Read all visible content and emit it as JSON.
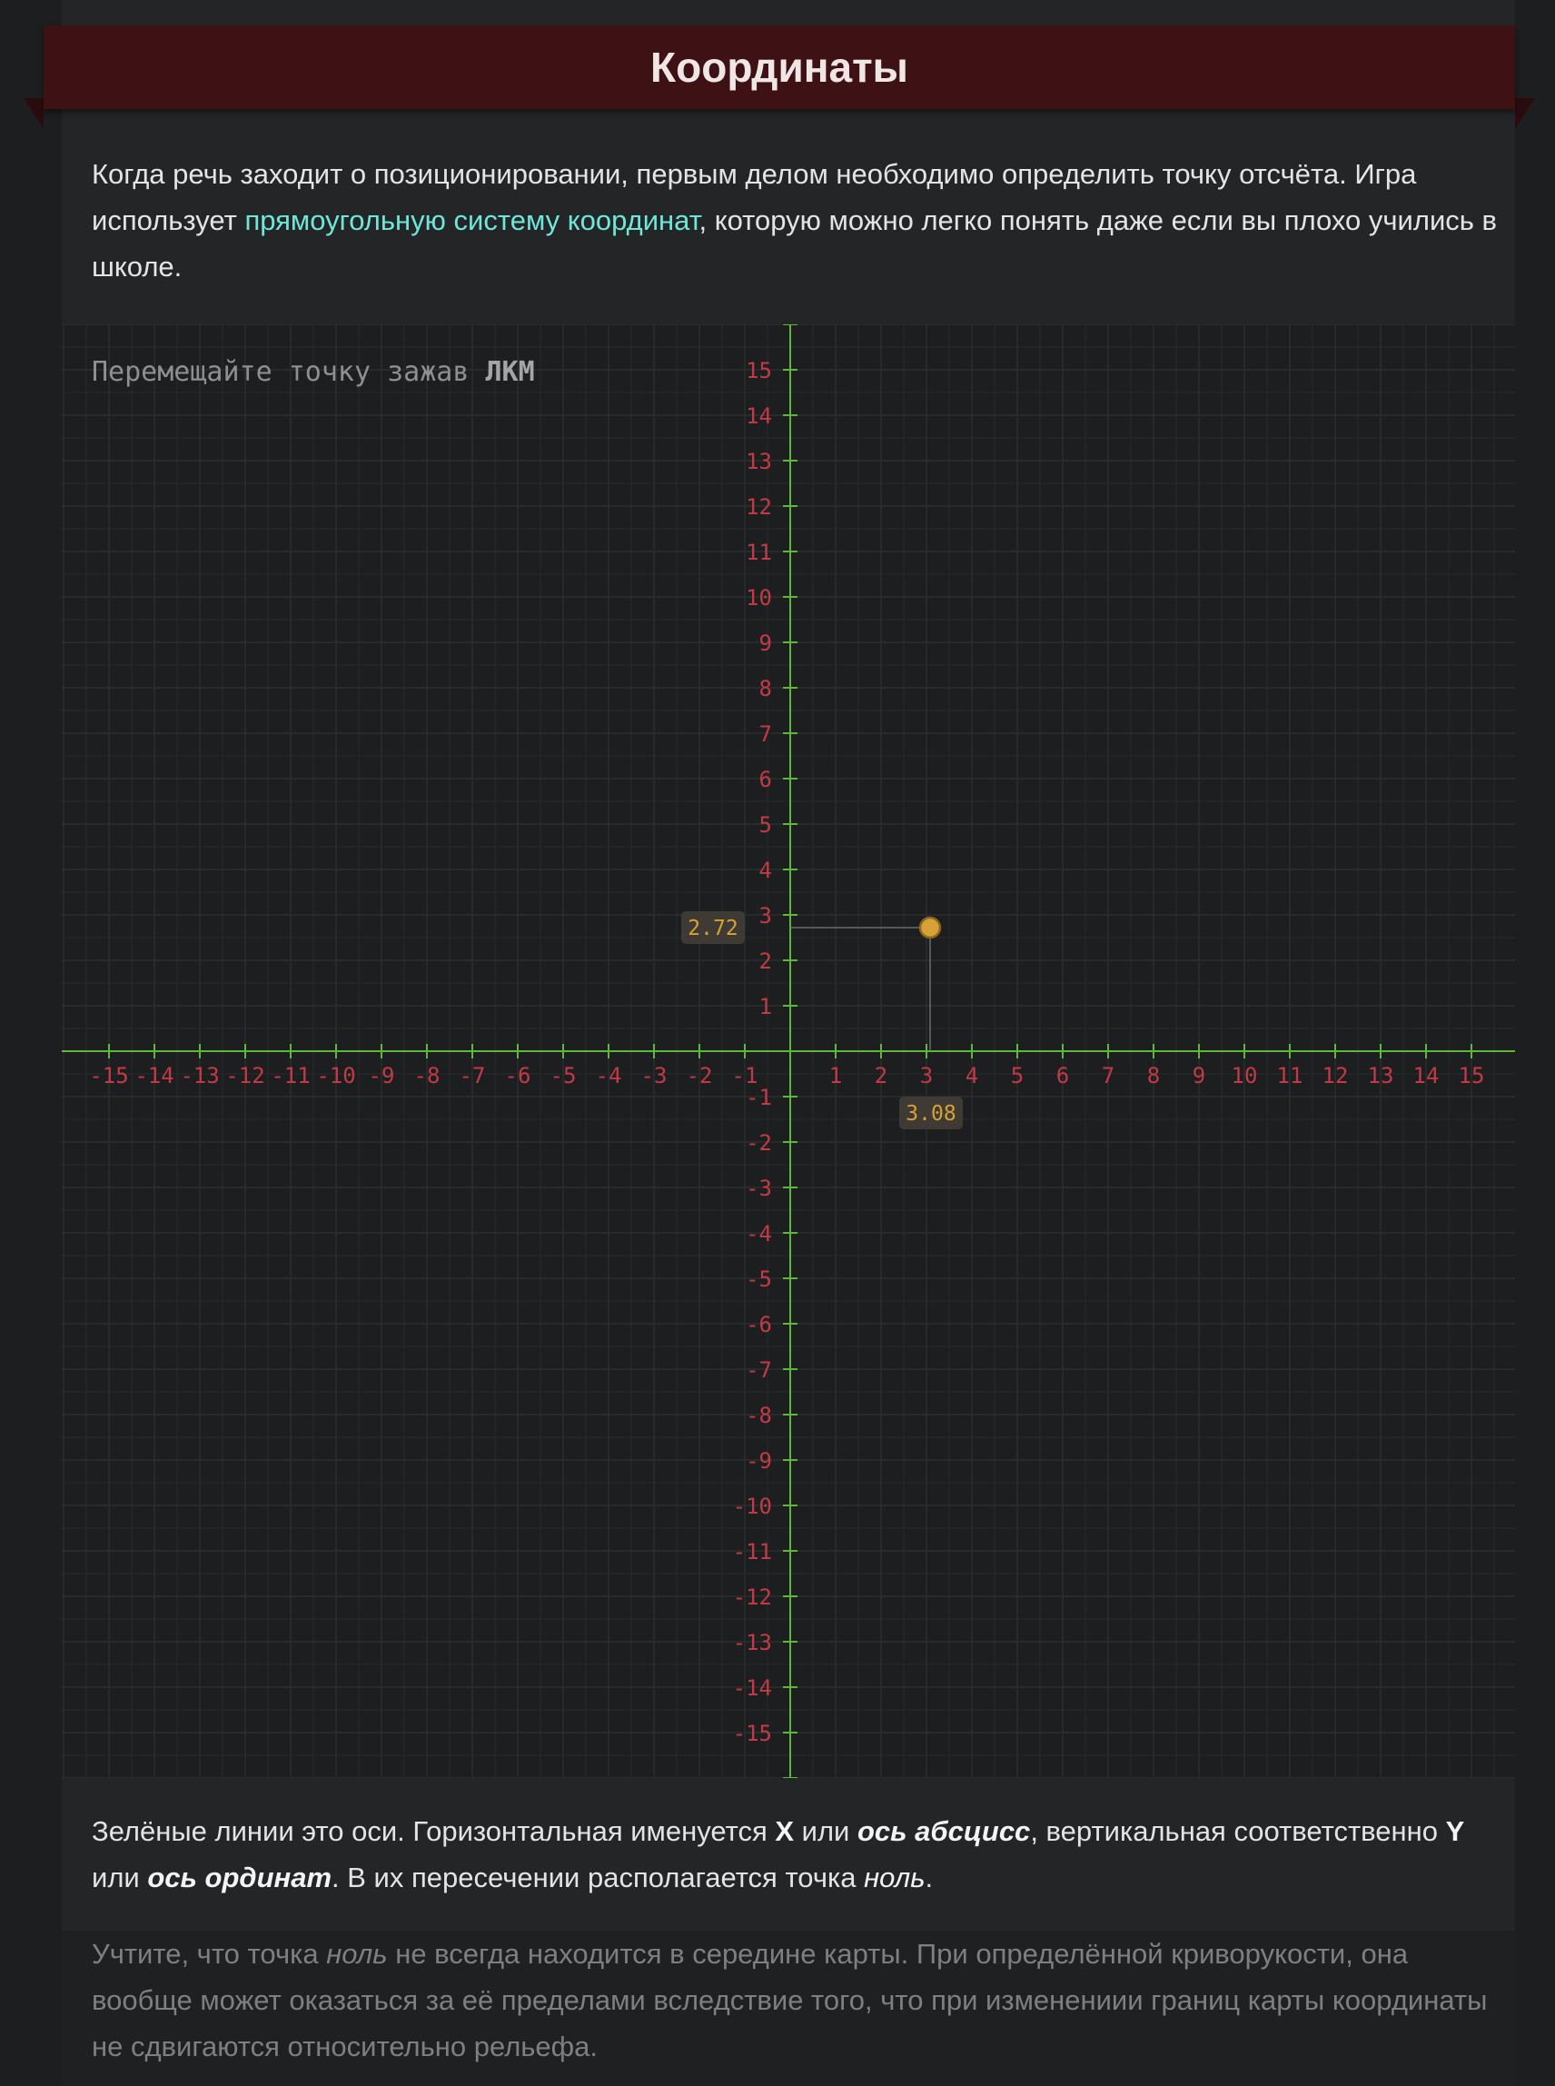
{
  "header": {
    "title": "Координаты"
  },
  "intro": {
    "text_before": "Когда речь заходит о позиционировании, первым делом необходимо определить точку отсчёта. Игра использует ",
    "link_text": "прямоугольную систему координат",
    "text_after": ", которую можно легко понять даже если вы плохо учились в школе."
  },
  "hint": {
    "text": "Перемещайте точку зажав ",
    "key": "ЛКМ"
  },
  "chart_data": {
    "type": "scatter",
    "xlim": [
      -16,
      16
    ],
    "ylim": [
      -16,
      16
    ],
    "x_ticks": [
      -15,
      -14,
      -13,
      -12,
      -11,
      -10,
      -9,
      -8,
      -7,
      -6,
      -5,
      -4,
      -3,
      -2,
      -1,
      1,
      2,
      3,
      4,
      5,
      6,
      7,
      8,
      9,
      10,
      11,
      12,
      13,
      14,
      15
    ],
    "y_ticks": [
      -15,
      -14,
      -13,
      -12,
      -11,
      -10,
      -9,
      -8,
      -7,
      -6,
      -5,
      -4,
      -3,
      -2,
      -1,
      1,
      2,
      3,
      4,
      5,
      6,
      7,
      8,
      9,
      10,
      11,
      12,
      13,
      14,
      15
    ],
    "grid": true,
    "point": {
      "x": 3.08,
      "y": 2.72,
      "x_label": "3.08",
      "y_label": "2.72"
    },
    "colors": {
      "axis": "#5fb83a",
      "tick_label": "#c23a46",
      "grid": "#2c2e30",
      "point": "#d6a236",
      "value_label": "#d6a236",
      "value_bg": "#3f3a34"
    }
  },
  "axes_paragraph": {
    "t1": "Зелёные линии это оси. Горизонтальная именуется ",
    "x": "X",
    "t2": " или ",
    "x_name": "ось абсцисс",
    "t3": ", вертикальная соответственно ",
    "y": "Y",
    "t4": " или ",
    "y_name": "ось ординат",
    "t5": ". В их пересечении располагается точка ",
    "zero": "ноль",
    "t6": "."
  },
  "note_paragraph": {
    "t1": "Учтите, что точка ",
    "zero": "ноль",
    "t2": " не всегда находится в середине карты. При определённой криворукости, она вообще может оказаться за её пределами вследствие того, что при изменениии границ карты координаты не сдвигаются относительно рельефа."
  }
}
